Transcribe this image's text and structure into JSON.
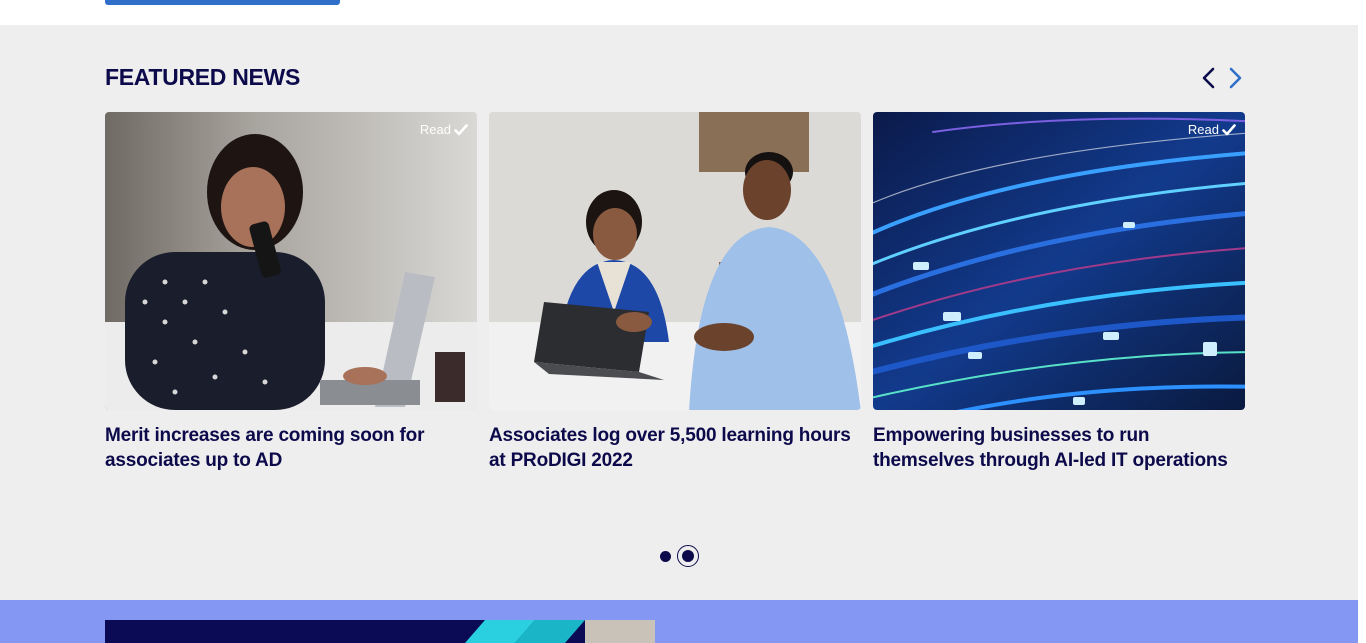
{
  "section": {
    "title": "FEATURED NEWS"
  },
  "nav": {
    "prev_icon": "chevron-left-icon",
    "next_icon": "chevron-right-icon"
  },
  "cards": [
    {
      "title": "Merit increases are coming soon for associates up to AD",
      "read_label": "Read",
      "read": true
    },
    {
      "title": "Associates log over 5,500 learning hours at PRoDIGI 2022",
      "read_label": "",
      "read": false
    },
    {
      "title": "Empowering businesses to run themselves through AI-led IT operations",
      "read_label": "Read",
      "read": true
    }
  ],
  "pager": {
    "pages": 2,
    "active_page": 2
  },
  "colors": {
    "brand_navy": "#0c0a4a",
    "accent_blue": "#2f6fc9",
    "band_periwinkle": "#8498f3",
    "section_bg": "#eeeeee"
  }
}
